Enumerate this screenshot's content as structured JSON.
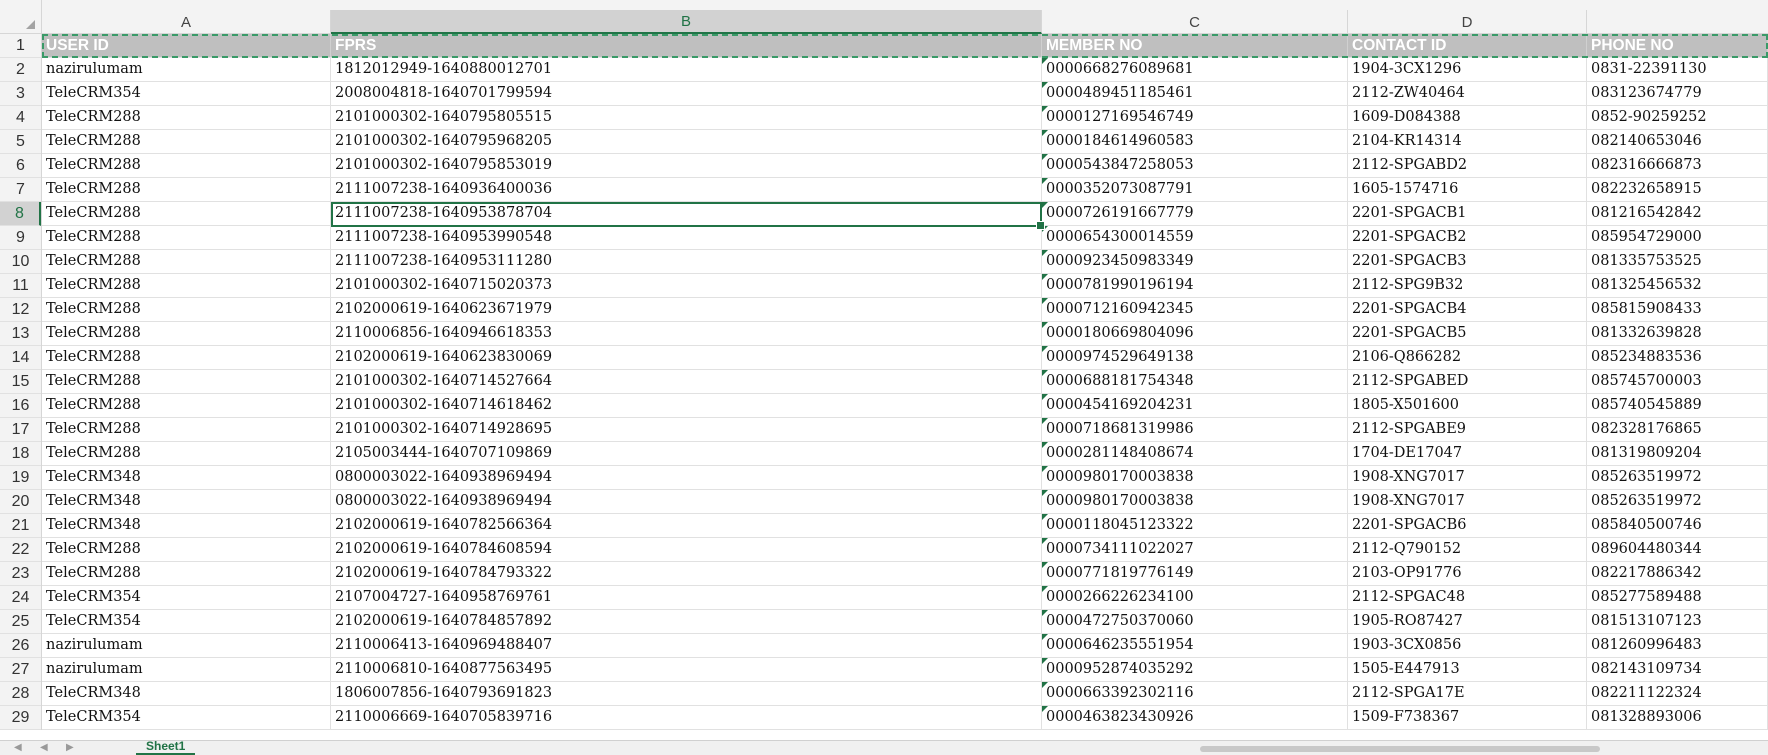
{
  "columns": [
    "A",
    "B",
    "C",
    "D"
  ],
  "header": [
    "USER ID",
    "FPRS",
    "MEMBER NO",
    "CONTACT ID",
    "PHONE NO"
  ],
  "rows": [
    [
      "nazirulumam",
      "1812012949-1640880012701",
      "0000668276089681",
      "1904-3CX1296",
      "0831-22391130"
    ],
    [
      "TeleCRM354",
      "2008004818-1640701799594",
      "0000489451185461",
      "2112-ZW40464",
      "083123674779"
    ],
    [
      "TeleCRM288",
      "2101000302-1640795805515",
      "0000127169546749",
      "1609-D084388",
      "0852-90259252"
    ],
    [
      "TeleCRM288",
      "2101000302-1640795968205",
      "0000184614960583",
      "2104-KR14314",
      "082140653046"
    ],
    [
      "TeleCRM288",
      "2101000302-1640795853019",
      "0000543847258053",
      "2112-SPGABD2",
      "082316666873"
    ],
    [
      "TeleCRM288",
      "2111007238-1640936400036",
      "0000352073087791",
      "1605-1574716",
      "082232658915"
    ],
    [
      "TeleCRM288",
      "2111007238-1640953878704",
      "0000726191667779",
      "2201-SPGACB1",
      "081216542842"
    ],
    [
      "TeleCRM288",
      "2111007238-1640953990548",
      "0000654300014559",
      "2201-SPGACB2",
      "085954729000"
    ],
    [
      "TeleCRM288",
      "2111007238-1640953111280",
      "0000923450983349",
      "2201-SPGACB3",
      "081335753525"
    ],
    [
      "TeleCRM288",
      "2101000302-1640715020373",
      "0000781990196194",
      "2112-SPG9B32",
      "081325456532"
    ],
    [
      "TeleCRM288",
      "2102000619-1640623671979",
      "0000712160942345",
      "2201-SPGACB4",
      "085815908433"
    ],
    [
      "TeleCRM288",
      "2110006856-1640946618353",
      "0000180669804096",
      "2201-SPGACB5",
      "081332639828"
    ],
    [
      "TeleCRM288",
      "2102000619-1640623830069",
      "0000974529649138",
      "2106-Q866282",
      "085234883536"
    ],
    [
      "TeleCRM288",
      "2101000302-1640714527664",
      "0000688181754348",
      "2112-SPGABED",
      "085745700003"
    ],
    [
      "TeleCRM288",
      "2101000302-1640714618462",
      "0000454169204231",
      "1805-X501600",
      "085740545889"
    ],
    [
      "TeleCRM288",
      "2101000302-1640714928695",
      "0000718681319986",
      "2112-SPGABE9",
      "082328176865"
    ],
    [
      "TeleCRM288",
      "2105003444-1640707109869",
      "0000281148408674",
      "1704-DE17047",
      "081319809204"
    ],
    [
      "TeleCRM348",
      "0800003022-1640938969494",
      "0000980170003838",
      "1908-XNG7017",
      "085263519972"
    ],
    [
      "TeleCRM348",
      "0800003022-1640938969494",
      "0000980170003838",
      "1908-XNG7017",
      "085263519972"
    ],
    [
      "TeleCRM348",
      "2102000619-1640782566364",
      "0000118045123322",
      "2201-SPGACB6",
      "085840500746"
    ],
    [
      "TeleCRM288",
      "2102000619-1640784608594",
      "0000734111022027",
      "2112-Q790152",
      "089604480344"
    ],
    [
      "TeleCRM288",
      "2102000619-1640784793322",
      "0000771819776149",
      "2103-OP91776",
      "082217886342"
    ],
    [
      "TeleCRM354",
      "2107004727-1640958769761",
      "0000266226234100",
      "2112-SPGAC48",
      "085277589488"
    ],
    [
      "TeleCRM354",
      "2102000619-1640784857892",
      "0000472750370060",
      "1905-RO87427",
      "081513107123"
    ],
    [
      "nazirulumam",
      "2110006413-1640969488407",
      "0000646235551954",
      "1903-3CX0856",
      "081260996483"
    ],
    [
      "nazirulumam",
      "2110006810-1640877563495",
      "0000952874035292",
      "1505-E447913",
      "082143109734"
    ],
    [
      "TeleCRM348",
      "1806007856-1640793691823",
      "0000663392302116",
      "2112-SPGA17E",
      "082211122324"
    ],
    [
      "TeleCRM354",
      "2110006669-1640705839716",
      "0000463823430926",
      "1509-F738367",
      "081328893006"
    ]
  ],
  "selected_cell": "B8",
  "selected_column": "B",
  "selected_row": 8,
  "sheet_tab": "Sheet1",
  "colors": {
    "accent": "#217346",
    "header_fill": "#bfbfbf"
  }
}
